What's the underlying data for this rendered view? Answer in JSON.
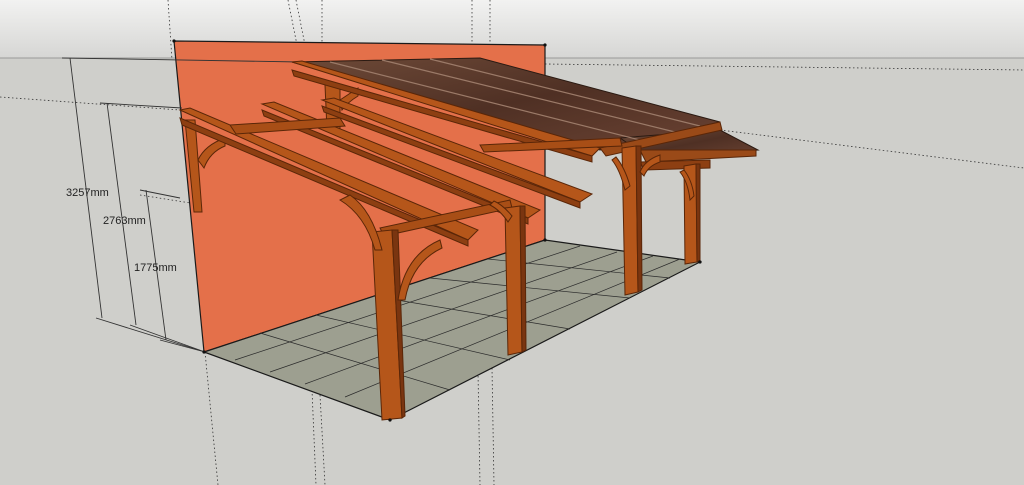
{
  "dimensions": [
    {
      "label": "3257mm"
    },
    {
      "label": "2763mm"
    },
    {
      "label": "1775mm"
    }
  ],
  "colors": {
    "sky": "#dcdcda",
    "ground": "#cfcfcb",
    "wall": "#e4704a",
    "floor": "#9d9f90",
    "timber": "#b5561a",
    "timber_dark": "#7a3510",
    "roof": "#5c3a2a",
    "line": "#1a1a1a"
  }
}
